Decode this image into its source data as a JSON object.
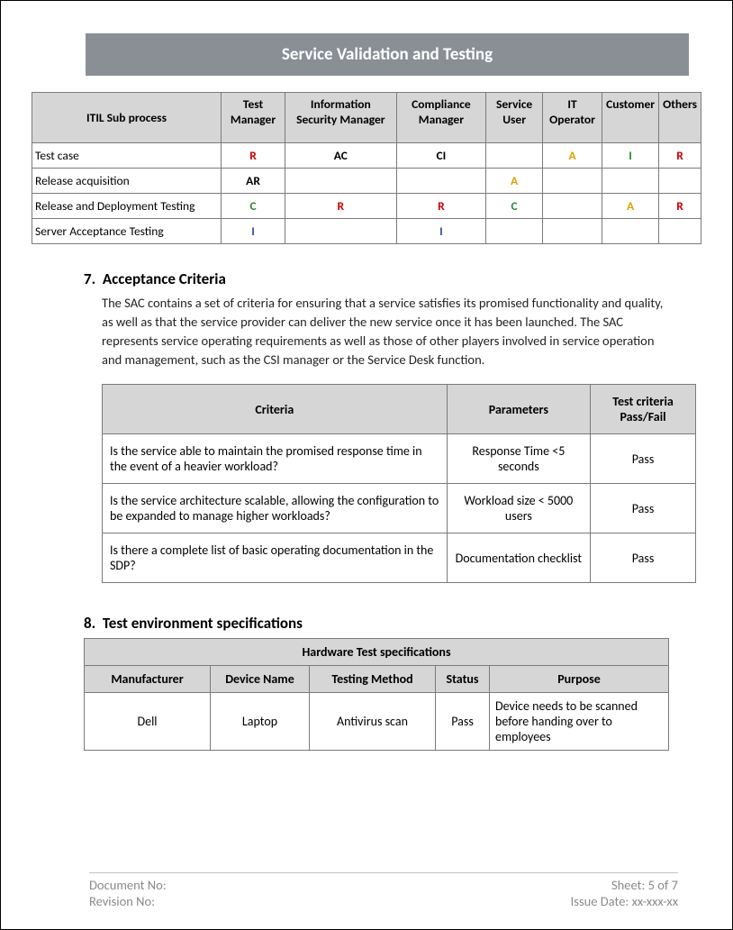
{
  "title": "Service Validation and Testing",
  "raci_headers": [
    "ITIL Sub process",
    "Test Manager",
    "Information Security Manager",
    "Compliance Manager",
    "Service User",
    "IT Operator",
    "Customer",
    "Others"
  ],
  "raci_rows": [
    {
      "label": "Test case",
      "cells": [
        {
          "t": "R",
          "c": "R"
        },
        {
          "t": "AC",
          "c": "plain"
        },
        {
          "t": "CI",
          "c": "plain"
        },
        {
          "t": "",
          "c": ""
        },
        {
          "t": "A",
          "c": "A"
        },
        {
          "t": "I",
          "c": "C"
        },
        {
          "t": "R",
          "c": "R"
        }
      ]
    },
    {
      "label": "Release acquisition",
      "cells": [
        {
          "t": "AR",
          "c": "plain"
        },
        {
          "t": "",
          "c": ""
        },
        {
          "t": "",
          "c": ""
        },
        {
          "t": "A",
          "c": "A"
        },
        {
          "t": "",
          "c": ""
        },
        {
          "t": "",
          "c": ""
        },
        {
          "t": "",
          "c": ""
        }
      ]
    },
    {
      "label": "Release and Deployment Testing",
      "cells": [
        {
          "t": "C",
          "c": "C"
        },
        {
          "t": "R",
          "c": "R"
        },
        {
          "t": "R",
          "c": "R"
        },
        {
          "t": "C",
          "c": "C"
        },
        {
          "t": "",
          "c": ""
        },
        {
          "t": "A",
          "c": "A"
        },
        {
          "t": "R",
          "c": "R"
        }
      ]
    },
    {
      "label": "Server Acceptance Testing",
      "cells": [
        {
          "t": "I",
          "c": "I"
        },
        {
          "t": "",
          "c": ""
        },
        {
          "t": "I",
          "c": "I"
        },
        {
          "t": "",
          "c": ""
        },
        {
          "t": "",
          "c": ""
        },
        {
          "t": "",
          "c": ""
        },
        {
          "t": "",
          "c": ""
        }
      ]
    }
  ],
  "section7": {
    "num": "7.",
    "title": "Acceptance Criteria",
    "body": "The SAC contains a set of criteria for ensuring that a service satisfies its promised functionality and quality, as well as that the service provider can deliver the new service once it has been launched. The SAC represents service operating requirements as well as those of other players involved in service operation and management, such as the CSI manager or the Service Desk function."
  },
  "criteria_headers": [
    "Criteria",
    "Parameters",
    "Test criteria Pass/Fail"
  ],
  "criteria_rows": [
    {
      "c": "Is the service able to maintain the promised response time in the event of a heavier workload?",
      "p": "Response Time <5 seconds",
      "r": "Pass"
    },
    {
      "c": " Is the service architecture scalable, allowing the configuration to be expanded to manage higher workloads?",
      "p": "Workload size < 5000 users",
      "r": "Pass"
    },
    {
      "c": "Is there a complete list of basic operating documentation in the SDP?",
      "p": "Documentation checklist",
      "r": "Pass"
    }
  ],
  "section8": {
    "num": "8.",
    "title": "Test environment specifications"
  },
  "hw_title": "Hardware Test specifications",
  "hw_headers": [
    "Manufacturer",
    "Device Name",
    "Testing Method",
    "Status",
    "Purpose"
  ],
  "hw_rows": [
    {
      "m": "Dell",
      "d": "Laptop",
      "t": "Antivirus scan",
      "s": "Pass",
      "p": "Device needs to be scanned before handing over to employees"
    }
  ],
  "footer": {
    "doc_no_label": "Document No:",
    "rev_no_label": "Revision No:",
    "sheet": "Sheet: 5 of 7",
    "issue": "Issue Date: xx-xxx-xx"
  }
}
